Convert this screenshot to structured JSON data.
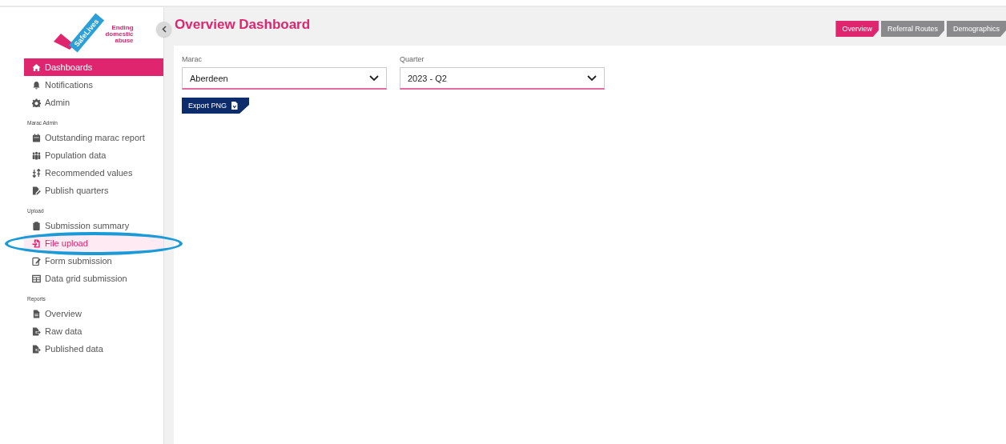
{
  "logo": {
    "brand": "SafeLives",
    "tagline": [
      "Ending",
      "domestic",
      "abuse"
    ]
  },
  "sidebar": {
    "sections": [
      {
        "items": [
          {
            "label": "Dashboards",
            "active": true,
            "selected": false
          },
          {
            "label": "Notifications",
            "active": false,
            "selected": false
          },
          {
            "label": "Admin",
            "active": false,
            "selected": false
          }
        ]
      },
      {
        "heading": "Marac Admin",
        "items": [
          {
            "label": "Outstanding marac report",
            "active": false,
            "selected": false
          },
          {
            "label": "Population data",
            "active": false,
            "selected": false
          },
          {
            "label": "Recommended values",
            "active": false,
            "selected": false
          },
          {
            "label": "Publish quarters",
            "active": false,
            "selected": false
          }
        ]
      },
      {
        "heading": "Upload",
        "items": [
          {
            "label": "Submission summary",
            "active": false,
            "selected": false
          },
          {
            "label": "File upload",
            "active": false,
            "selected": true
          },
          {
            "label": "Form submission",
            "active": false,
            "selected": false
          },
          {
            "label": "Data grid submission",
            "active": false,
            "selected": false
          }
        ]
      },
      {
        "heading": "Reports",
        "items": [
          {
            "label": "Overview",
            "active": false,
            "selected": false
          },
          {
            "label": "Raw data",
            "active": false,
            "selected": false
          },
          {
            "label": "Published data",
            "active": false,
            "selected": false
          }
        ]
      }
    ]
  },
  "page": {
    "title": "Overview Dashboard",
    "tabs": [
      {
        "label": "Overview",
        "selected": true
      },
      {
        "label": "Referral Routes",
        "selected": false
      },
      {
        "label": "Demographics",
        "selected": false
      }
    ],
    "filters": [
      {
        "label": "Marac",
        "value": "Aberdeen"
      },
      {
        "label": "Quarter",
        "value": "2023 - Q2"
      }
    ],
    "export_button": "Export PNG"
  }
}
